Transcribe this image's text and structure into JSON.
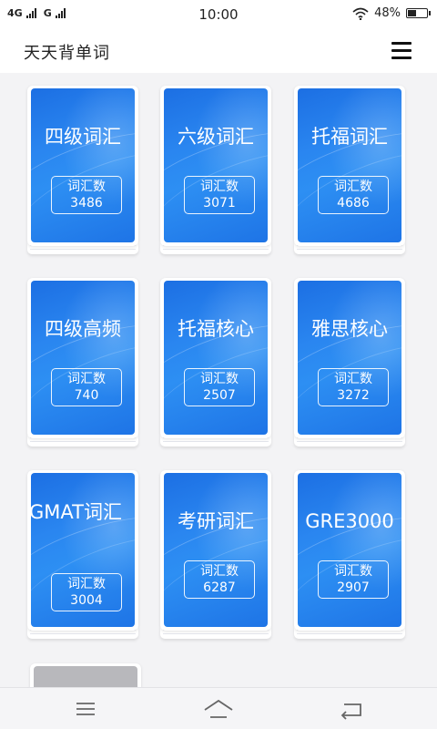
{
  "status": {
    "network1": "4G",
    "network2": "G",
    "time": "10:00",
    "battery_text": "48%",
    "battery_level": 0.48
  },
  "app": {
    "title": "天天背单词",
    "menu_icon": "hamburger-menu-icon"
  },
  "books": [
    {
      "title": "四级词汇",
      "count_label": "词汇数",
      "count": "3486"
    },
    {
      "title": "六级词汇",
      "count_label": "词汇数",
      "count": "3071"
    },
    {
      "title": "托福词汇",
      "count_label": "词汇数",
      "count": "4686"
    },
    {
      "title": "四级高频",
      "count_label": "词汇数",
      "count": "740"
    },
    {
      "title": "托福核心",
      "count_label": "词汇数",
      "count": "2507"
    },
    {
      "title": "雅思核心",
      "count_label": "词汇数",
      "count": "3272"
    },
    {
      "title": "GMAT词汇",
      "count_label": "词汇数",
      "count": "3004"
    },
    {
      "title": "考研词汇",
      "count_label": "词汇数",
      "count": "6287"
    },
    {
      "title": "GRE3000",
      "count_label": "词汇数",
      "count": "2907"
    }
  ],
  "navigation": {
    "menu_icon": "menu-lines-icon",
    "home_icon": "home-icon",
    "back_icon": "back-arrow-icon"
  },
  "colors": {
    "cover_blue": "#2a86f0",
    "background": "#f3f3f5"
  }
}
